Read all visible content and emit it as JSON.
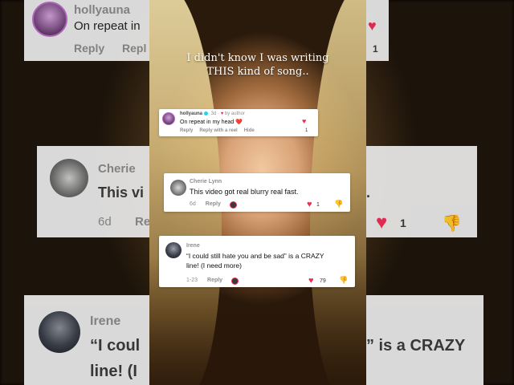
{
  "overlay": {
    "line1": "I didn't know I was writing",
    "line2": "THIS kind of song.."
  },
  "background_comments": {
    "top": {
      "user": "hollyauna",
      "text": "On repeat in",
      "reply": "Reply",
      "reply2": "Repl",
      "count": "1"
    },
    "middle": {
      "user": "Cherie",
      "text": "This vi",
      "text_right": ".",
      "date": "6d",
      "reply": "Re",
      "count": "1"
    },
    "bottom": {
      "user": "Irene",
      "text_left": "“I coul",
      "text_right": "” is a CRAZY",
      "line2": "line! (I"
    }
  },
  "comments": [
    {
      "user": "hollyauna",
      "badge": "· 3d · ",
      "by_author": "by author",
      "text": "On repeat in my head ❤️",
      "actions": [
        "Reply",
        "Reply with a reel",
        "Hide"
      ],
      "likes": "1"
    },
    {
      "user": "Cherie Lynn",
      "text": "This video got real blurry real fast.",
      "date": "6d",
      "actions": [
        "Reply"
      ],
      "likes": "1"
    },
    {
      "user": "Irene",
      "text_line1": "“I could still hate you and be sad” is a CRAZY",
      "text_line2": "line! (I need more)",
      "date": "1-23",
      "actions": [
        "Reply"
      ],
      "likes": "79"
    }
  ],
  "colors": {
    "heart": "#ee2c55",
    "verified": "#20d5ec"
  }
}
